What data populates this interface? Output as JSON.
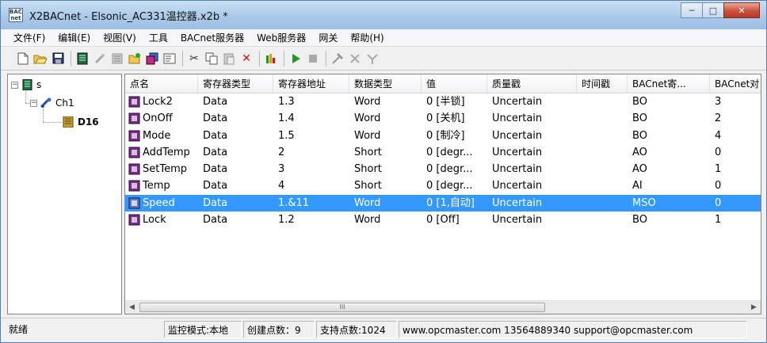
{
  "window": {
    "title": "X2BACnet - Elsonic_AC331温控器.x2b *",
    "app_icon_label": "BAC net"
  },
  "menu": [
    "文件(F)",
    "编辑(E)",
    "视图(V)",
    "工具",
    "BACnet服务器",
    "Web服务器",
    "网关",
    "帮助(H)"
  ],
  "toolbar": [
    "new-icon",
    "open-icon",
    "save-icon",
    "channel-icon",
    "add-device-icon",
    "device-icon",
    "add-tag-icon",
    "multi-tag-icon",
    "properties-icon",
    "cut-icon",
    "copy-icon",
    "paste-icon",
    "delete-icon",
    "monitor-icon",
    "run-icon",
    "stop-icon",
    "tools-icon",
    "config-icon",
    "settings-icon"
  ],
  "tree": {
    "root": "s",
    "channel": "Ch1",
    "device": "D16"
  },
  "table": {
    "columns": [
      "点名",
      "寄存器类型",
      "寄存器地址",
      "数据类型",
      "值",
      "质量戳",
      "时间戳",
      "BACnet寄...",
      "BACnet对"
    ],
    "rows": [
      [
        "Lock2",
        "Data",
        "1.3",
        "Word",
        "0 [半锁]",
        "Uncertain",
        "",
        "BO",
        "3"
      ],
      [
        "OnOff",
        "Data",
        "1.4",
        "Word",
        "0 [关机]",
        "Uncertain",
        "",
        "BO",
        "2"
      ],
      [
        "Mode",
        "Data",
        "1.5",
        "Word",
        "0 [制冷]",
        "Uncertain",
        "",
        "BO",
        "4"
      ],
      [
        "AddTemp",
        "Data",
        "2",
        "Short",
        "0 [degr...",
        "Uncertain",
        "",
        "AO",
        "0"
      ],
      [
        "SetTemp",
        "Data",
        "3",
        "Short",
        "0 [degr...",
        "Uncertain",
        "",
        "AO",
        "1"
      ],
      [
        "Temp",
        "Data",
        "4",
        "Short",
        "0 [degr...",
        "Uncertain",
        "",
        "AI",
        "0"
      ],
      [
        "Speed",
        "Data",
        "1.&11",
        "Word",
        "0 [1,自动]",
        "Uncertain",
        "",
        "MSO",
        "0"
      ],
      [
        "Lock",
        "Data",
        "1.2",
        "Word",
        "0 [Off]",
        "Uncertain",
        "",
        "BO",
        "1"
      ]
    ],
    "selected_row": 6,
    "scroll_thumb_label": "III"
  },
  "status": {
    "ready": "就绪",
    "monitor_mode": "监控模式:本地",
    "created_points": "创建点数：9",
    "supported_points": "支持点数:1024",
    "contact": "www.opcmaster.com 13564889340 support@opcmaster.com"
  },
  "colors": {
    "selection": "#3399ff",
    "tag_icon": "#7a2a8a",
    "run": "#1e9a1e"
  }
}
